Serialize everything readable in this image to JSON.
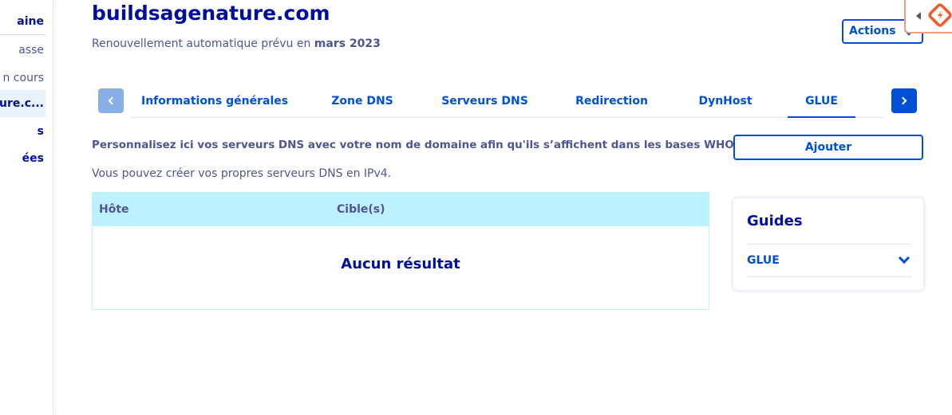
{
  "sidebar": {
    "items": [
      {
        "label": "aine"
      },
      {
        "label": "asse"
      },
      {
        "label": "n cours"
      },
      {
        "label": "ure.c..."
      },
      {
        "label": "s"
      },
      {
        "label": "ées"
      }
    ]
  },
  "header": {
    "title": "buildsagenature.com",
    "subtitle_prefix": "Renouvellement automatique prévu en ",
    "subtitle_date": "mars 2023",
    "actions_label": "Actions"
  },
  "tabs": [
    {
      "label": "Informations générales"
    },
    {
      "label": "Zone DNS"
    },
    {
      "label": "Serveurs DNS"
    },
    {
      "label": "Redirection"
    },
    {
      "label": "DynHost"
    },
    {
      "label": "GLUE",
      "active": true
    }
  ],
  "content": {
    "intro_bold": "Personnalisez ici vos serveurs DNS avec votre nom de domaine afin qu'ils s’affichent dans les bases WHOIS.",
    "intro": "Vous pouvez créer vos propres serveurs DNS en IPv4.",
    "add_label": "Ajouter",
    "table": {
      "columns": [
        "Hôte",
        "Cible(s)"
      ],
      "empty_text": "Aucun résultat"
    }
  },
  "guides": {
    "title": "Guides",
    "items": [
      {
        "label": "GLUE"
      }
    ]
  },
  "colors": {
    "primary": "#0050d7",
    "title": "#000e9c",
    "text": "#4d5693",
    "table_header": "#bef1ff",
    "widget_accent": "#f05a28"
  },
  "icons": {
    "prev": "chevron-left-icon",
    "next": "chevron-right-icon",
    "actions": "chevron-down-icon",
    "guide": "chevron-down-icon",
    "widget": "orange-logo-icon"
  }
}
